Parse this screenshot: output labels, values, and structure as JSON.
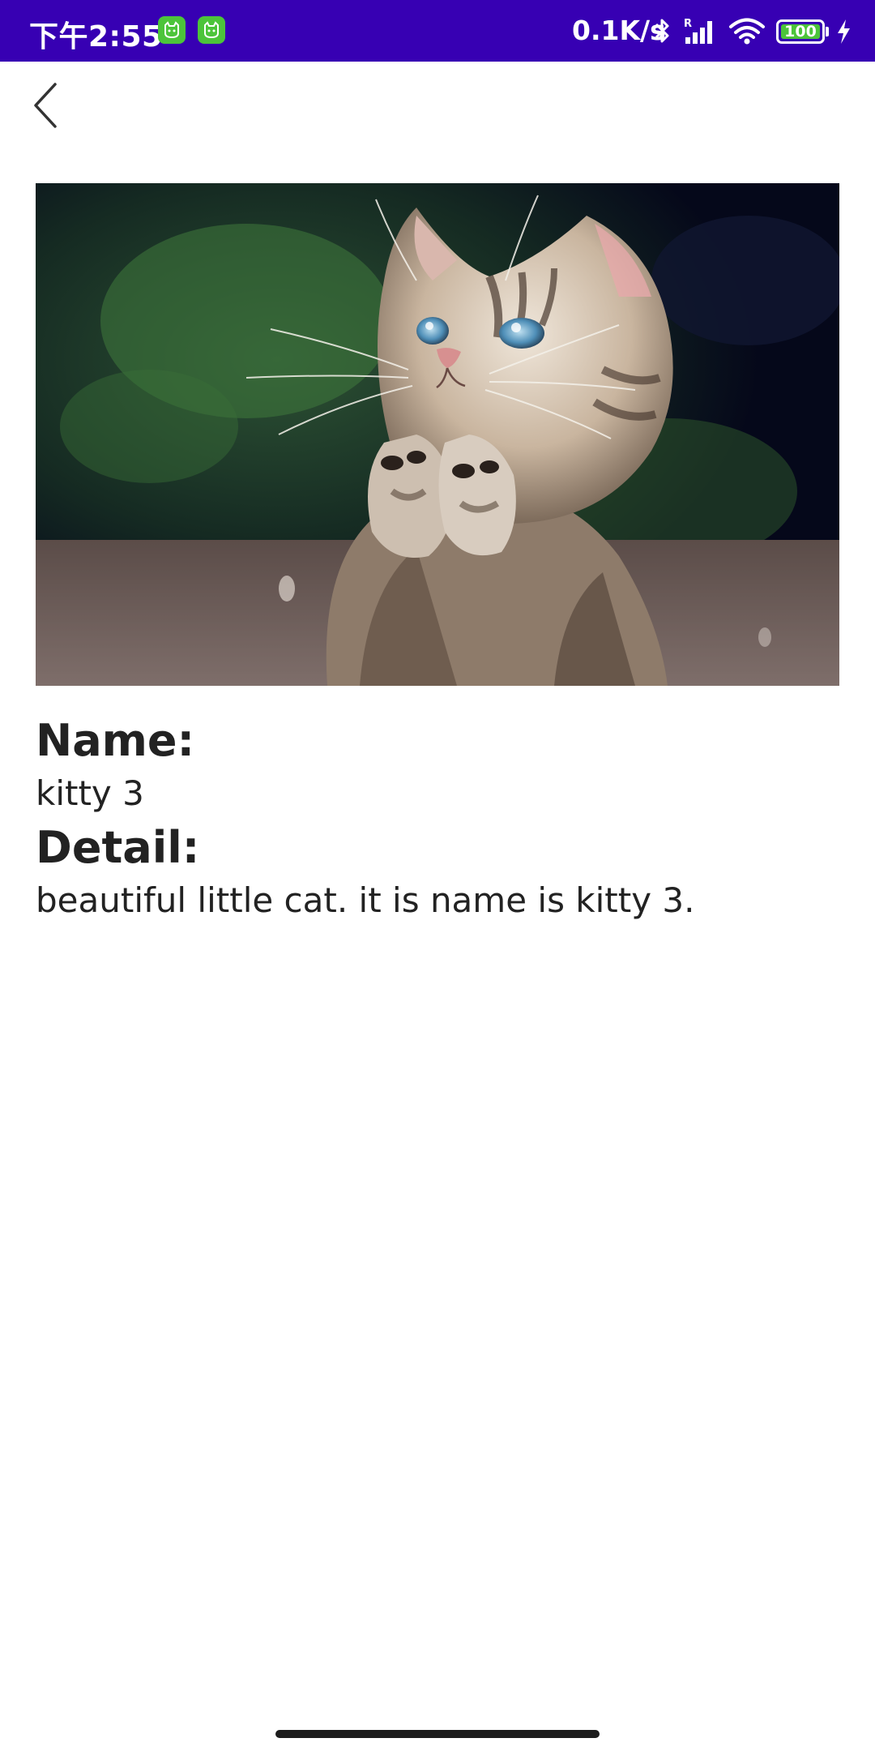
{
  "status_bar": {
    "time": "下午2:55",
    "network_speed": "0.1K/s",
    "battery_level": "100",
    "background_color": "#3700b3",
    "icons": [
      "app-notification-icon",
      "app-notification-icon",
      "bluetooth-icon",
      "signal-icon",
      "wifi-icon",
      "battery-icon",
      "charging-icon"
    ]
  },
  "toolbar": {
    "back_icon": "chevron-left-icon"
  },
  "detail": {
    "name_label": "Name:",
    "name_value": "kitty 3",
    "detail_label": "Detail:",
    "detail_value": "beautiful little cat. it is name is kitty 3."
  }
}
